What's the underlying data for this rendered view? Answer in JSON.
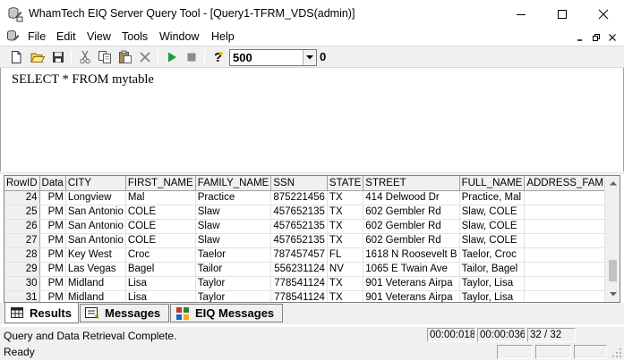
{
  "window": {
    "title": "WhamTech EIQ Server Query Tool - [Query1-TFRM_VDS(admin)]",
    "icon": "database-icon"
  },
  "menu": {
    "items": [
      "File",
      "Edit",
      "View",
      "Tools",
      "Window",
      "Help"
    ]
  },
  "toolbar": {
    "row_limit": "500",
    "row_count": "0",
    "icons": [
      "new-icon",
      "open-icon",
      "save-icon",
      "cut-icon",
      "copy-icon",
      "paste-icon",
      "clear-icon",
      "run-icon",
      "stop-icon",
      "help-icon"
    ]
  },
  "editor": {
    "sql": "SELECT * FROM mytable"
  },
  "grid": {
    "columns": [
      "RowID",
      "Data",
      "CITY",
      "FIRST_NAME",
      "FAMILY_NAME",
      "SSN",
      "STATE",
      "STREET",
      "FULL_NAME",
      "ADDRESS_FAMILY_"
    ],
    "rows": [
      [
        "24",
        "PM",
        "Longview",
        "Mal",
        "Practice",
        "875221456",
        "TX",
        "414 Delwood Dr",
        "Practice, Mal",
        ""
      ],
      [
        "25",
        "PM",
        "San Antonio",
        "COLE",
        "Slaw",
        "457652135",
        "TX",
        "602 Gembler Rd",
        "Slaw, COLE",
        ""
      ],
      [
        "26",
        "PM",
        "San Antonio",
        "COLE",
        "Slaw",
        "457652135",
        "TX",
        "602 Gembler Rd",
        "Slaw, COLE",
        ""
      ],
      [
        "27",
        "PM",
        "San Antonio",
        "COLE",
        "Slaw",
        "457652135",
        "TX",
        "602 Gembler Rd",
        "Slaw, COLE",
        ""
      ],
      [
        "28",
        "PM",
        "Key West",
        "Croc",
        "Taelor",
        "787457457",
        "FL",
        "1618 N Roosevelt B",
        "Taelor, Croc",
        ""
      ],
      [
        "29",
        "PM",
        "Las Vegas",
        "Bagel",
        "Tailor",
        "556231124",
        "NV",
        "1065 E Twain Ave",
        "Tailor, Bagel",
        ""
      ],
      [
        "30",
        "PM",
        "Midland",
        "Lisa",
        "Taylor",
        "778541124",
        "TX",
        "901 Veterans Airpa",
        "Taylor, Lisa",
        ""
      ],
      [
        "31",
        "PM",
        "Midland",
        "Lisa",
        "Taylor",
        "778541124",
        "TX",
        "901 Veterans Airpa",
        "Taylor, Lisa",
        ""
      ]
    ]
  },
  "tabs": [
    {
      "label": "Results",
      "active": true
    },
    {
      "label": "Messages",
      "active": false
    },
    {
      "label": "EIQ Messages",
      "active": false
    }
  ],
  "status": {
    "message": "Query and Data Retrieval Complete.",
    "elapsed_1": "00:00:018",
    "elapsed_2": "00:00:036",
    "rows": "32 / 32",
    "ready": "Ready"
  },
  "colors": {
    "run_green": "#1e9e3a",
    "chrome_gray": "#f0f0f0"
  }
}
